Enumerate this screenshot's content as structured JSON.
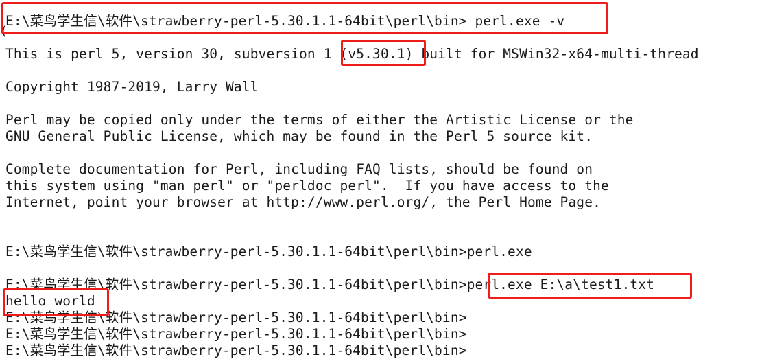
{
  "console": {
    "lines": [
      "E:\\菜鸟学生信\\软件\\strawberry-perl-5.30.1.1-64bit\\perl\\bin> perl.exe -v",
      "This is perl 5, version 30, subversion 1 (v5.30.1) built for MSWin32-x64-multi-thread",
      "Copyright 1987-2019, Larry Wall",
      "Perl may be copied only under the terms of either the Artistic License or the",
      "GNU General Public License, which may be found in the Perl 5 source kit.",
      "Complete documentation for Perl, including FAQ lists, should be found on",
      "this system using \"man perl\" or \"perldoc perl\".  If you have access to the",
      "Internet, point your browser at http://www.perl.org/, the Perl Home Page.",
      "E:\\菜鸟学生信\\软件\\strawberry-perl-5.30.1.1-64bit\\perl\\bin>perl.exe",
      "E:\\菜鸟学生信\\软件\\strawberry-perl-5.30.1.1-64bit\\perl\\bin>perl.exe E:\\a\\test1.txt",
      "hello world",
      "E:\\菜鸟学生信\\软件\\strawberry-perl-5.30.1.1-64bit\\perl\\bin>",
      "E:\\菜鸟学生信\\软件\\strawberry-perl-5.30.1.1-64bit\\perl\\bin>",
      "E:\\菜鸟学生信\\软件\\strawberry-perl-5.30.1.1-64bit\\perl\\bin>"
    ],
    "stray_char": "("
  },
  "colors": {
    "background": "#ffffff",
    "text": "#1a1a1a",
    "highlight": "#ef1c1c"
  }
}
